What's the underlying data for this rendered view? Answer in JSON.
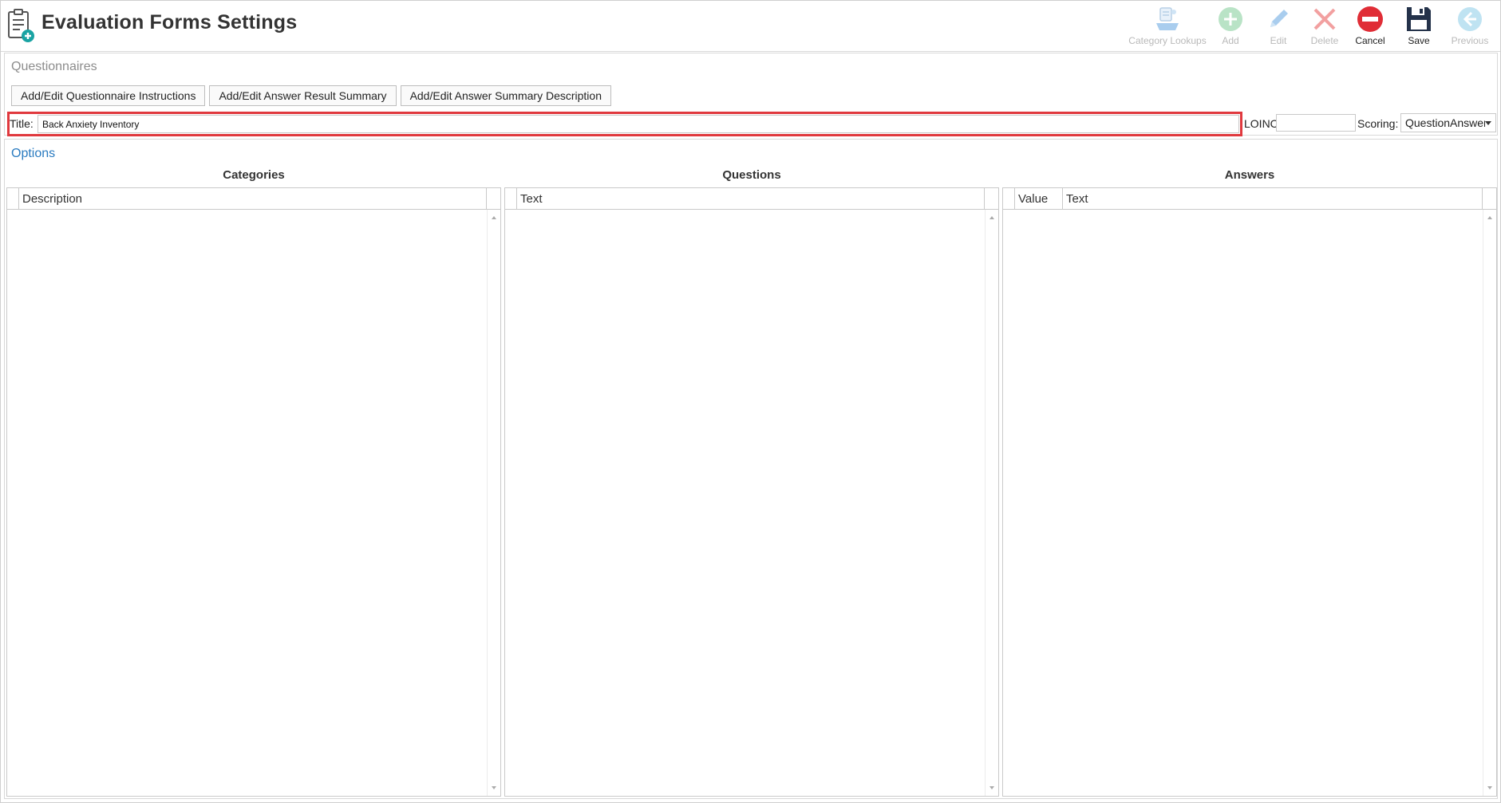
{
  "header": {
    "title": "Evaluation Forms Settings",
    "toolbar": {
      "category_lookups": "Category Lookups",
      "add": "Add",
      "edit": "Edit",
      "delete": "Delete",
      "cancel": "Cancel",
      "save": "Save",
      "previous": "Previous"
    }
  },
  "questionnaires": {
    "header": "Questionnaires",
    "buttons": {
      "instructions": "Add/Edit Questionnaire Instructions",
      "result_summary": "Add/Edit Answer Result Summary",
      "summary_description": "Add/Edit Answer Summary Description"
    },
    "title_label": "Title:",
    "title_value": "Back Anxiety Inventory",
    "loinc_label": "LOINC",
    "loinc_value": "",
    "scoring_label": "Scoring:",
    "scoring_value": "QuestionAnswer"
  },
  "options": {
    "header": "Options",
    "categories": {
      "title": "Categories",
      "columns": [
        "Description"
      ],
      "rows": []
    },
    "questions": {
      "title": "Questions",
      "columns": [
        "Text"
      ],
      "rows": []
    },
    "answers": {
      "title": "Answers",
      "columns": [
        "Value",
        "Text"
      ],
      "rows": []
    }
  },
  "colors": {
    "add_green": "#b9e3c6",
    "edit_blue": "#a9cdee",
    "delete_red": "#f2a0a0",
    "cancel_red": "#e02d36",
    "save_navy": "#24324a",
    "previous_blue": "#bfe3f2",
    "highlight_red": "#e0393e",
    "options_link": "#2a7bc0"
  }
}
